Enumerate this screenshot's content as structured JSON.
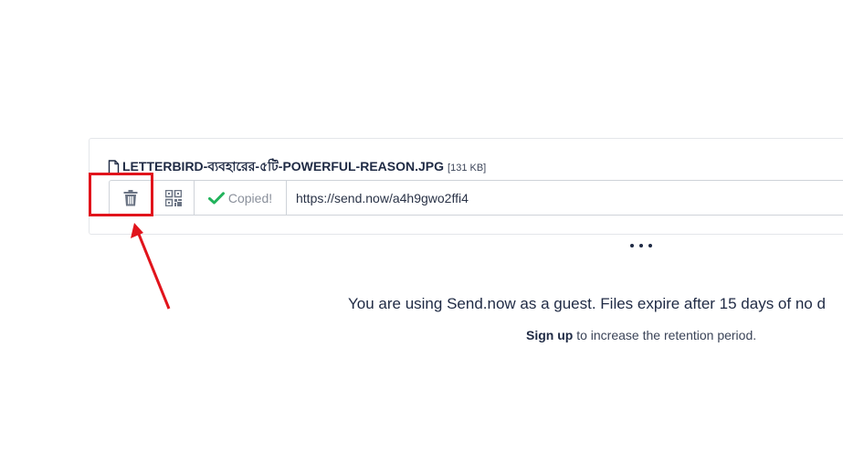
{
  "file": {
    "name": "LETTERBIRD-ব্যবহারের-৫টি-POWERFUL-REASON.JPG",
    "size": "[131 KB]",
    "copied_label": "Copied!",
    "share_link": "https://send.now/a4h9gwo2ffi4"
  },
  "icons": {
    "file": "file-icon",
    "delete": "trash-icon",
    "qr": "qr-code-icon",
    "check": "check-icon",
    "more": "more-dots-icon"
  },
  "notice": {
    "guest_message": "You are using Send.now as a guest. Files expire after 15 days of no d",
    "signup_link": "Sign up",
    "signup_suffix": " to increase the retention period."
  },
  "colors": {
    "annotation_red": "#e1141c",
    "check_green": "#22b35c",
    "text_dark": "#1f2a44",
    "icon_gray": "#6c7585"
  }
}
